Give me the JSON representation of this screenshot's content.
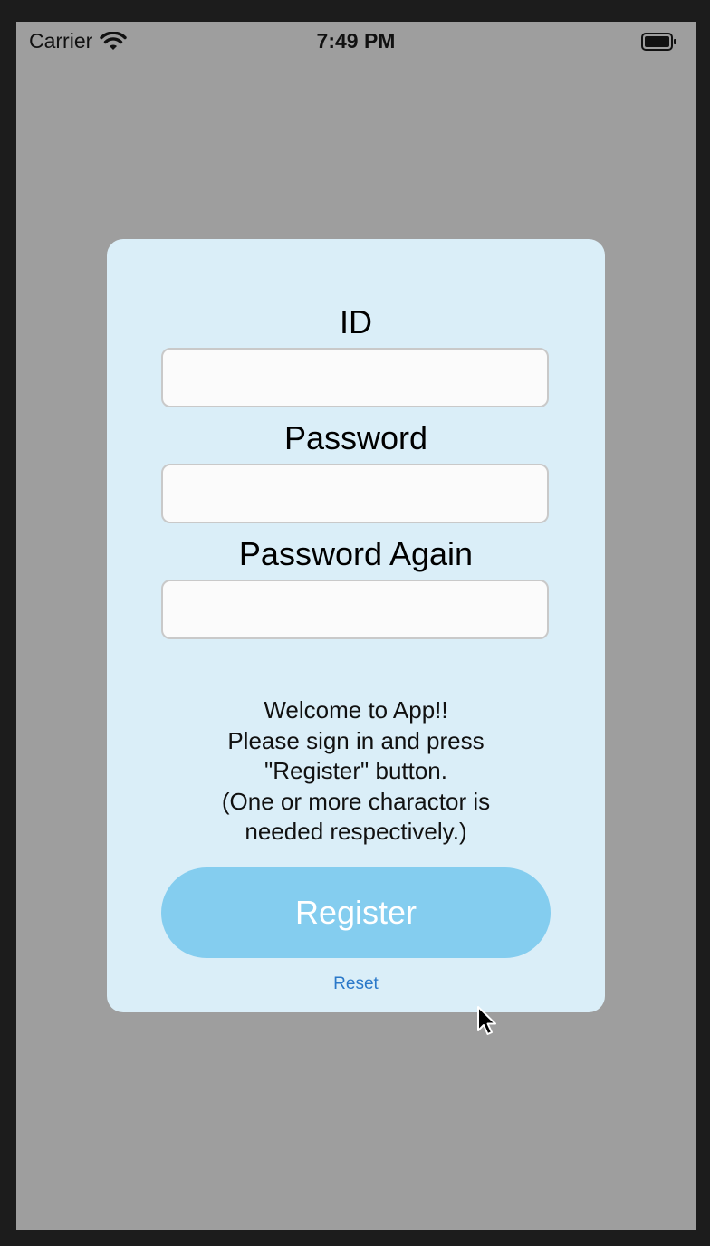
{
  "status_bar": {
    "carrier": "Carrier",
    "time": "7:49 PM",
    "icons": [
      "wifi-icon",
      "battery-icon"
    ]
  },
  "form": {
    "id_label": "ID",
    "id_value": "",
    "password_label": "Password",
    "password_value": "",
    "password_again_label": "Password Again",
    "password_again_value": "",
    "message_lines": [
      "Welcome to App!!",
      "Please sign in and press",
      "\"Register\" button.",
      "(One or more charactor is",
      "needed respectively.)"
    ],
    "register_label": "Register",
    "reset_label": "Reset"
  },
  "colors": {
    "backdrop": "#9e9e9e",
    "card": "#daeef8",
    "register_button": "#84cdef",
    "reset_link": "#2a78c9"
  }
}
